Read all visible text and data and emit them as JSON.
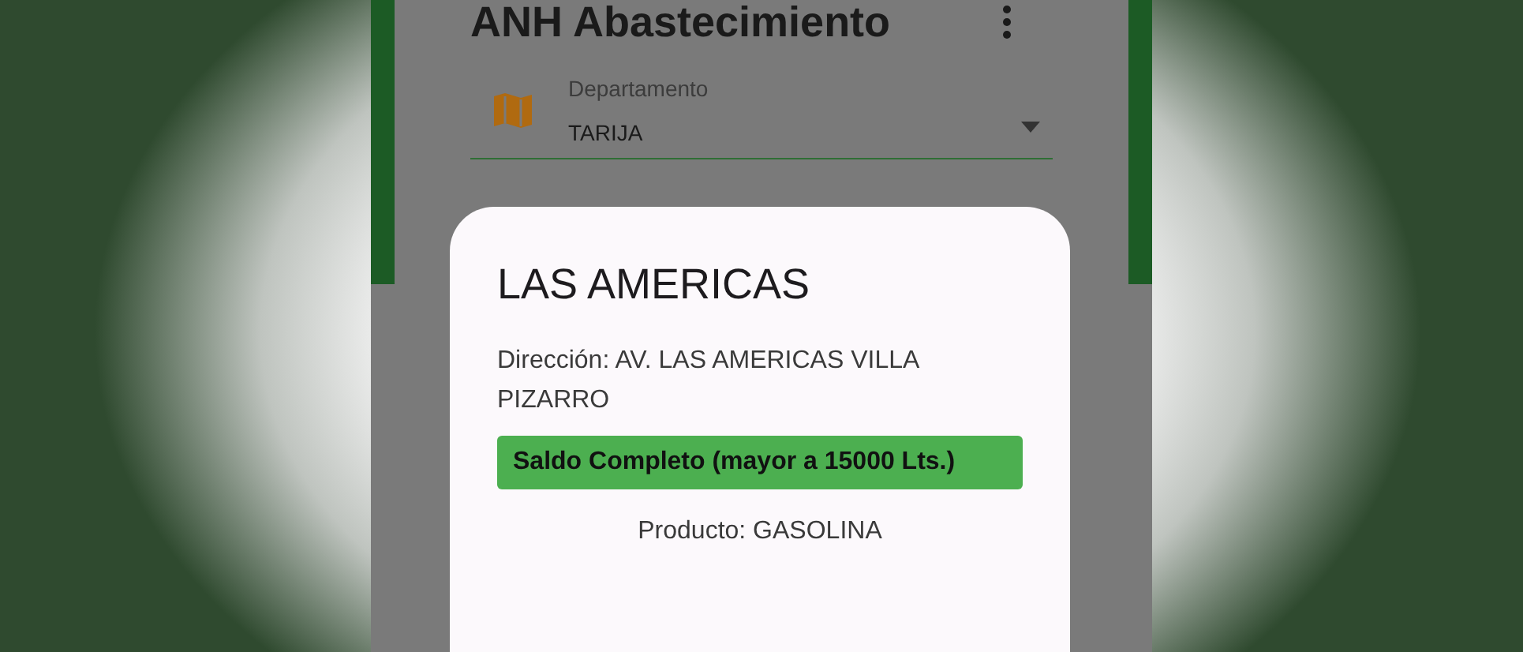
{
  "app_bar": {
    "title": "ANH Abastecimiento"
  },
  "department_field": {
    "label": "Departamento",
    "value": "TARIJA"
  },
  "dialog": {
    "title": "LAS AMERICAS",
    "address": "Dirección: AV. LAS AMERICAS VILLA PIZARRO",
    "status": {
      "label": "Saldo Completo (mayor a 15000 Lts.)",
      "color": "#4caf50"
    },
    "product": "Producto: GASOLINA"
  }
}
